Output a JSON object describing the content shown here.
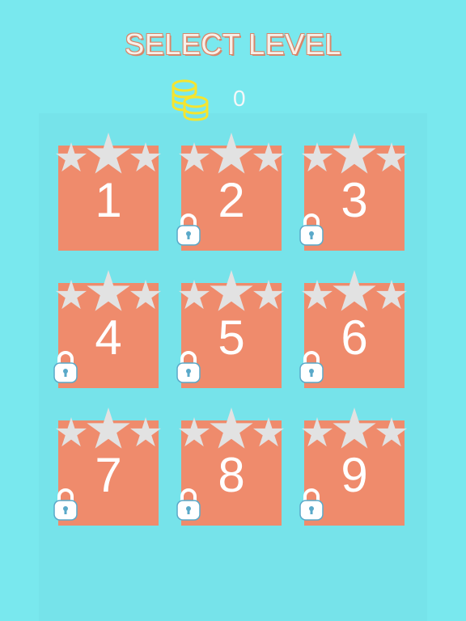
{
  "header": {
    "title": "SELECT LEVEL"
  },
  "coins": {
    "icon": "coins-icon",
    "count": "0",
    "color": "#f5e52f"
  },
  "colors": {
    "background": "#79e8ee",
    "tile": "#ef8b6c",
    "star": "#e2e2e2"
  },
  "levels": [
    {
      "number": "1",
      "locked": false,
      "stars": 0
    },
    {
      "number": "2",
      "locked": true,
      "stars": 0
    },
    {
      "number": "3",
      "locked": true,
      "stars": 0
    },
    {
      "number": "4",
      "locked": true,
      "stars": 0
    },
    {
      "number": "5",
      "locked": true,
      "stars": 0
    },
    {
      "number": "6",
      "locked": true,
      "stars": 0
    },
    {
      "number": "7",
      "locked": true,
      "stars": 0
    },
    {
      "number": "8",
      "locked": true,
      "stars": 0
    },
    {
      "number": "9",
      "locked": true,
      "stars": 0
    }
  ]
}
